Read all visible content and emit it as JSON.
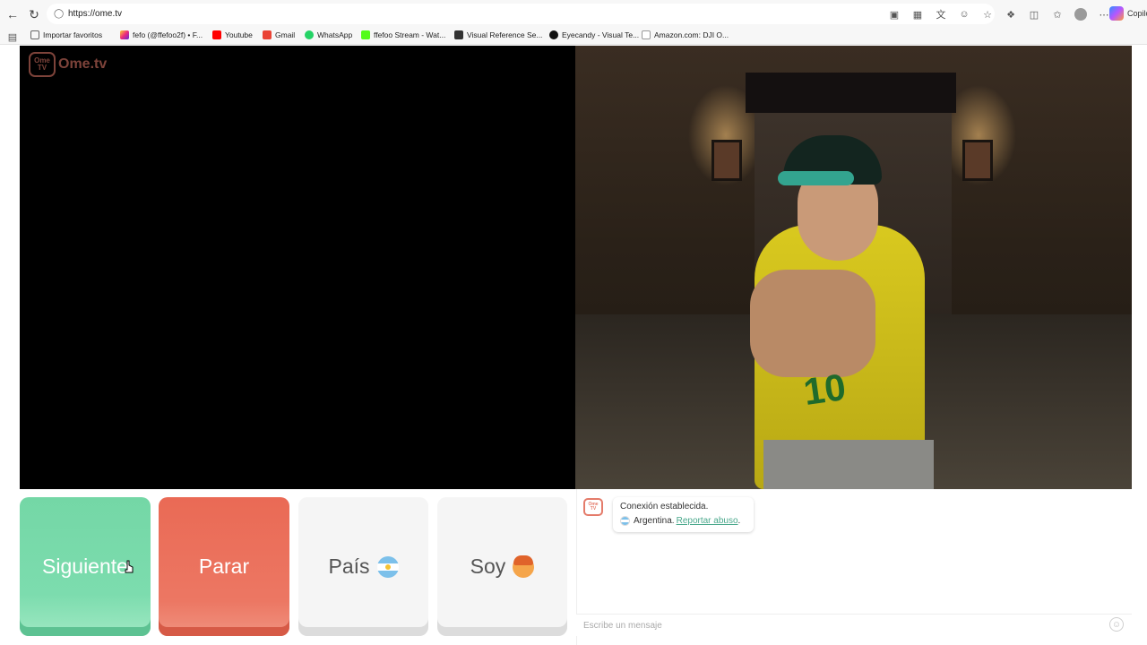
{
  "browser": {
    "url": "https://ome.tv",
    "copilot_label": "Copilo",
    "bookmarks": [
      {
        "label": "Importar favoritos",
        "icon": "folder-icon"
      },
      {
        "label": "fefo (@ffefoo2f) • F...",
        "icon": "instagram-icon"
      },
      {
        "label": "Youtube",
        "icon": "youtube-icon"
      },
      {
        "label": "Gmail",
        "icon": "gmail-icon"
      },
      {
        "label": "WhatsApp",
        "icon": "whatsapp-icon"
      },
      {
        "label": "ffefoo Stream - Wat...",
        "icon": "kick-icon"
      },
      {
        "label": "Visual Reference Se...",
        "icon": "visual-reference-icon"
      },
      {
        "label": "Eyecandy - Visual Te...",
        "icon": "eyecandy-icon"
      },
      {
        "label": "Amazon.com: DJI O...",
        "icon": "amazon-icon"
      }
    ]
  },
  "logo": {
    "badge": "Ome TV",
    "text": "Ome.tv"
  },
  "controls": {
    "next_label": "Siguiente",
    "stop_label": "Parar",
    "country_label": "País",
    "gender_label": "Soy"
  },
  "chat": {
    "avatar_text": "Ome TV",
    "status": "Conexión establecida.",
    "country": "Argentina.",
    "report_link": "Reportar abuso",
    "report_suffix": ".",
    "input_placeholder": "Escribe un mensaje"
  },
  "colors": {
    "next": "#74d7a6",
    "stop": "#ea6a55",
    "brand": "#e47b6a",
    "link": "#4aa88c"
  }
}
